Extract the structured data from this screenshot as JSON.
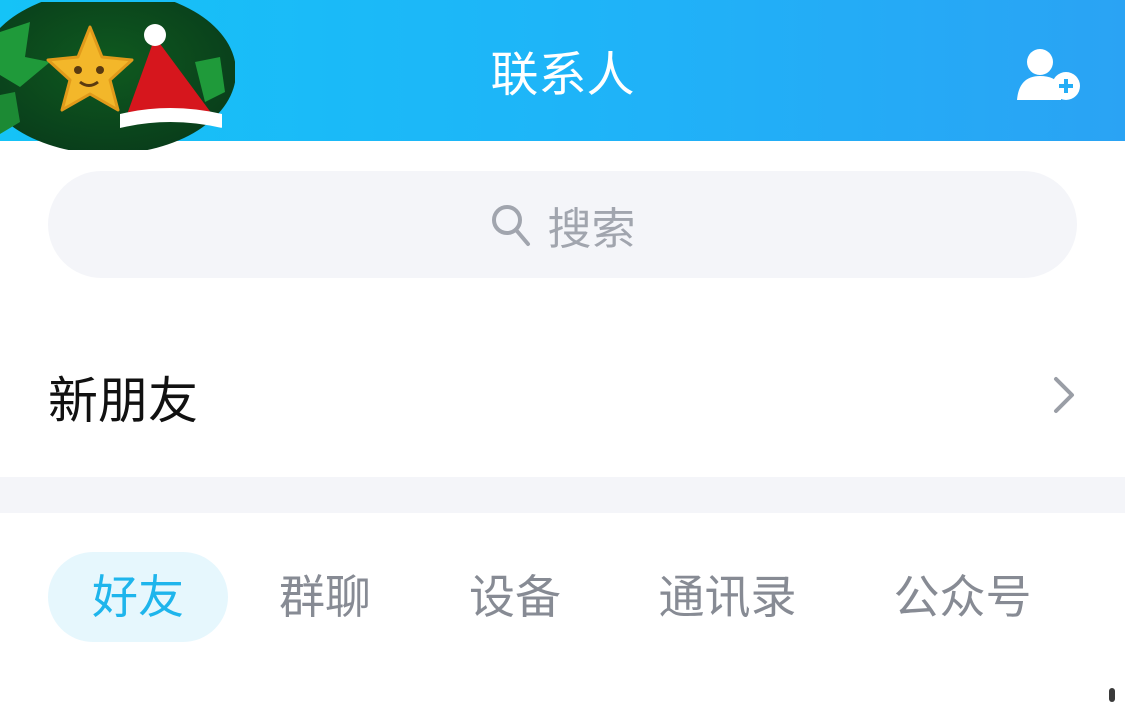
{
  "header": {
    "title": "联系人",
    "avatar_icon": "christmas-star-avatar",
    "add_contact_icon": "add-contact-icon"
  },
  "search": {
    "placeholder": "搜索",
    "icon": "search-icon"
  },
  "new_friends": {
    "label": "新朋友",
    "icon": "chevron-right-icon"
  },
  "tabs": [
    {
      "label": "好友",
      "active": true
    },
    {
      "label": "群聊",
      "active": false
    },
    {
      "label": "设备",
      "active": false
    },
    {
      "label": "通讯录",
      "active": false
    },
    {
      "label": "公众号",
      "active": false
    }
  ],
  "colors": {
    "header_start": "#15c3f7",
    "header_end": "#2aa3f4",
    "active_tab_text": "#1eb5ec",
    "active_tab_bg": "#e6f7fd",
    "inactive_tab_text": "#878b94",
    "search_bg": "#f4f5f9"
  }
}
